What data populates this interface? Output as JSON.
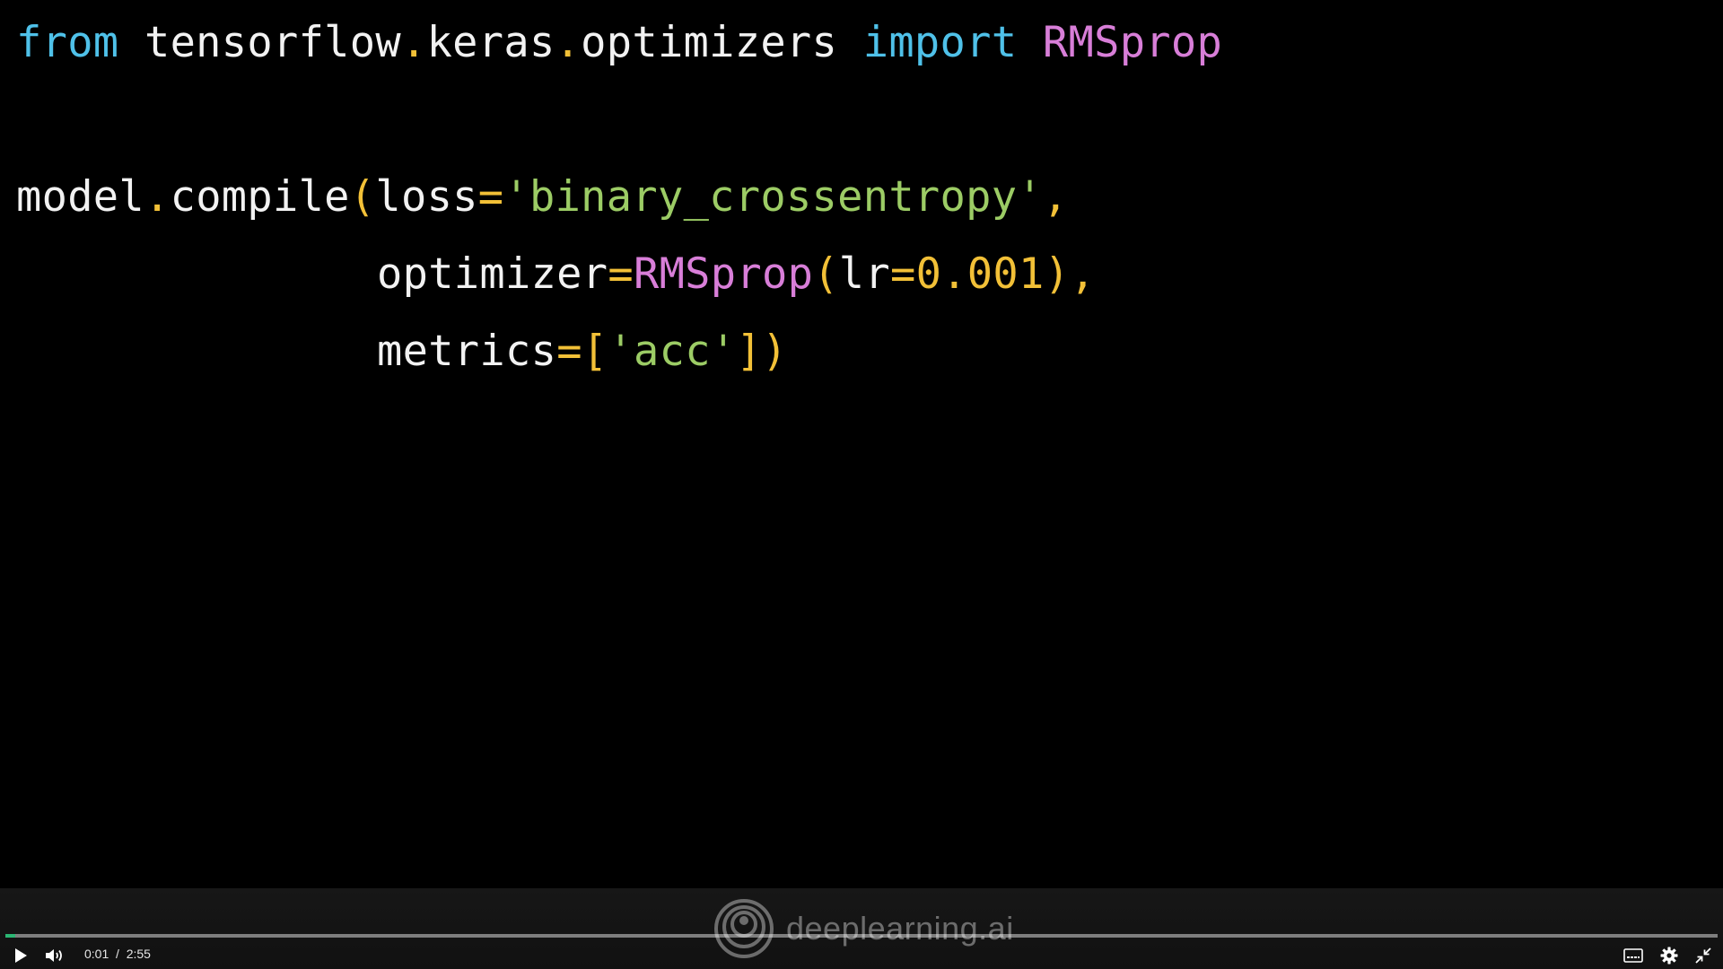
{
  "code": {
    "lines": [
      [
        {
          "text": "from",
          "color": "#4fc1e9"
        },
        {
          "text": " tensorflow",
          "color": "#f2f2f2"
        },
        {
          "text": ".",
          "color": "#f2c037"
        },
        {
          "text": "keras",
          "color": "#f2f2f2"
        },
        {
          "text": ".",
          "color": "#f2c037"
        },
        {
          "text": "optimizers ",
          "color": "#f2f2f2"
        },
        {
          "text": "import",
          "color": "#4fc1e9"
        },
        {
          "text": " RMSprop",
          "color": "#d87ed8"
        }
      ],
      [
        {
          "text": "model",
          "color": "#f2f2f2"
        },
        {
          "text": ".",
          "color": "#f2c037"
        },
        {
          "text": "compile",
          "color": "#f2f2f2"
        },
        {
          "text": "(",
          "color": "#f2c037"
        },
        {
          "text": "loss",
          "color": "#f2f2f2"
        },
        {
          "text": "=",
          "color": "#f2c037"
        },
        {
          "text": "'binary_crossentropy'",
          "color": "#9ccc65"
        },
        {
          "text": ",",
          "color": "#f2c037"
        }
      ],
      [
        {
          "text": "optimizer",
          "color": "#f2f2f2"
        },
        {
          "text": "=",
          "color": "#f2c037"
        },
        {
          "text": "RMSprop",
          "color": "#d87ed8"
        },
        {
          "text": "(",
          "color": "#f2c037"
        },
        {
          "text": "lr",
          "color": "#f2f2f2"
        },
        {
          "text": "=",
          "color": "#f2c037"
        },
        {
          "text": "0.001",
          "color": "#f2c037"
        },
        {
          "text": ")",
          "color": "#f2c037"
        },
        {
          "text": ",",
          "color": "#f2c037"
        }
      ],
      [
        {
          "text": "metrics",
          "color": "#f2f2f2"
        },
        {
          "text": "=",
          "color": "#f2c037"
        },
        {
          "text": "[",
          "color": "#f2c037"
        },
        {
          "text": "'acc'",
          "color": "#9ccc65"
        },
        {
          "text": "]",
          "color": "#f2c037"
        },
        {
          "text": ")",
          "color": "#f2c037"
        }
      ]
    ]
  },
  "watermark": {
    "text": "deeplearning.ai",
    "icon": "deeplearning-logo-icon"
  },
  "player": {
    "current_time": "0:01",
    "separator": "/",
    "duration": "2:55",
    "progress_fraction": 0.006,
    "accent_color": "#2bb673",
    "icons": {
      "play": "play-icon",
      "volume": "volume-icon",
      "captions": "captions-icon",
      "settings": "gear-icon",
      "exit_fullscreen": "exit-fullscreen-icon"
    }
  }
}
